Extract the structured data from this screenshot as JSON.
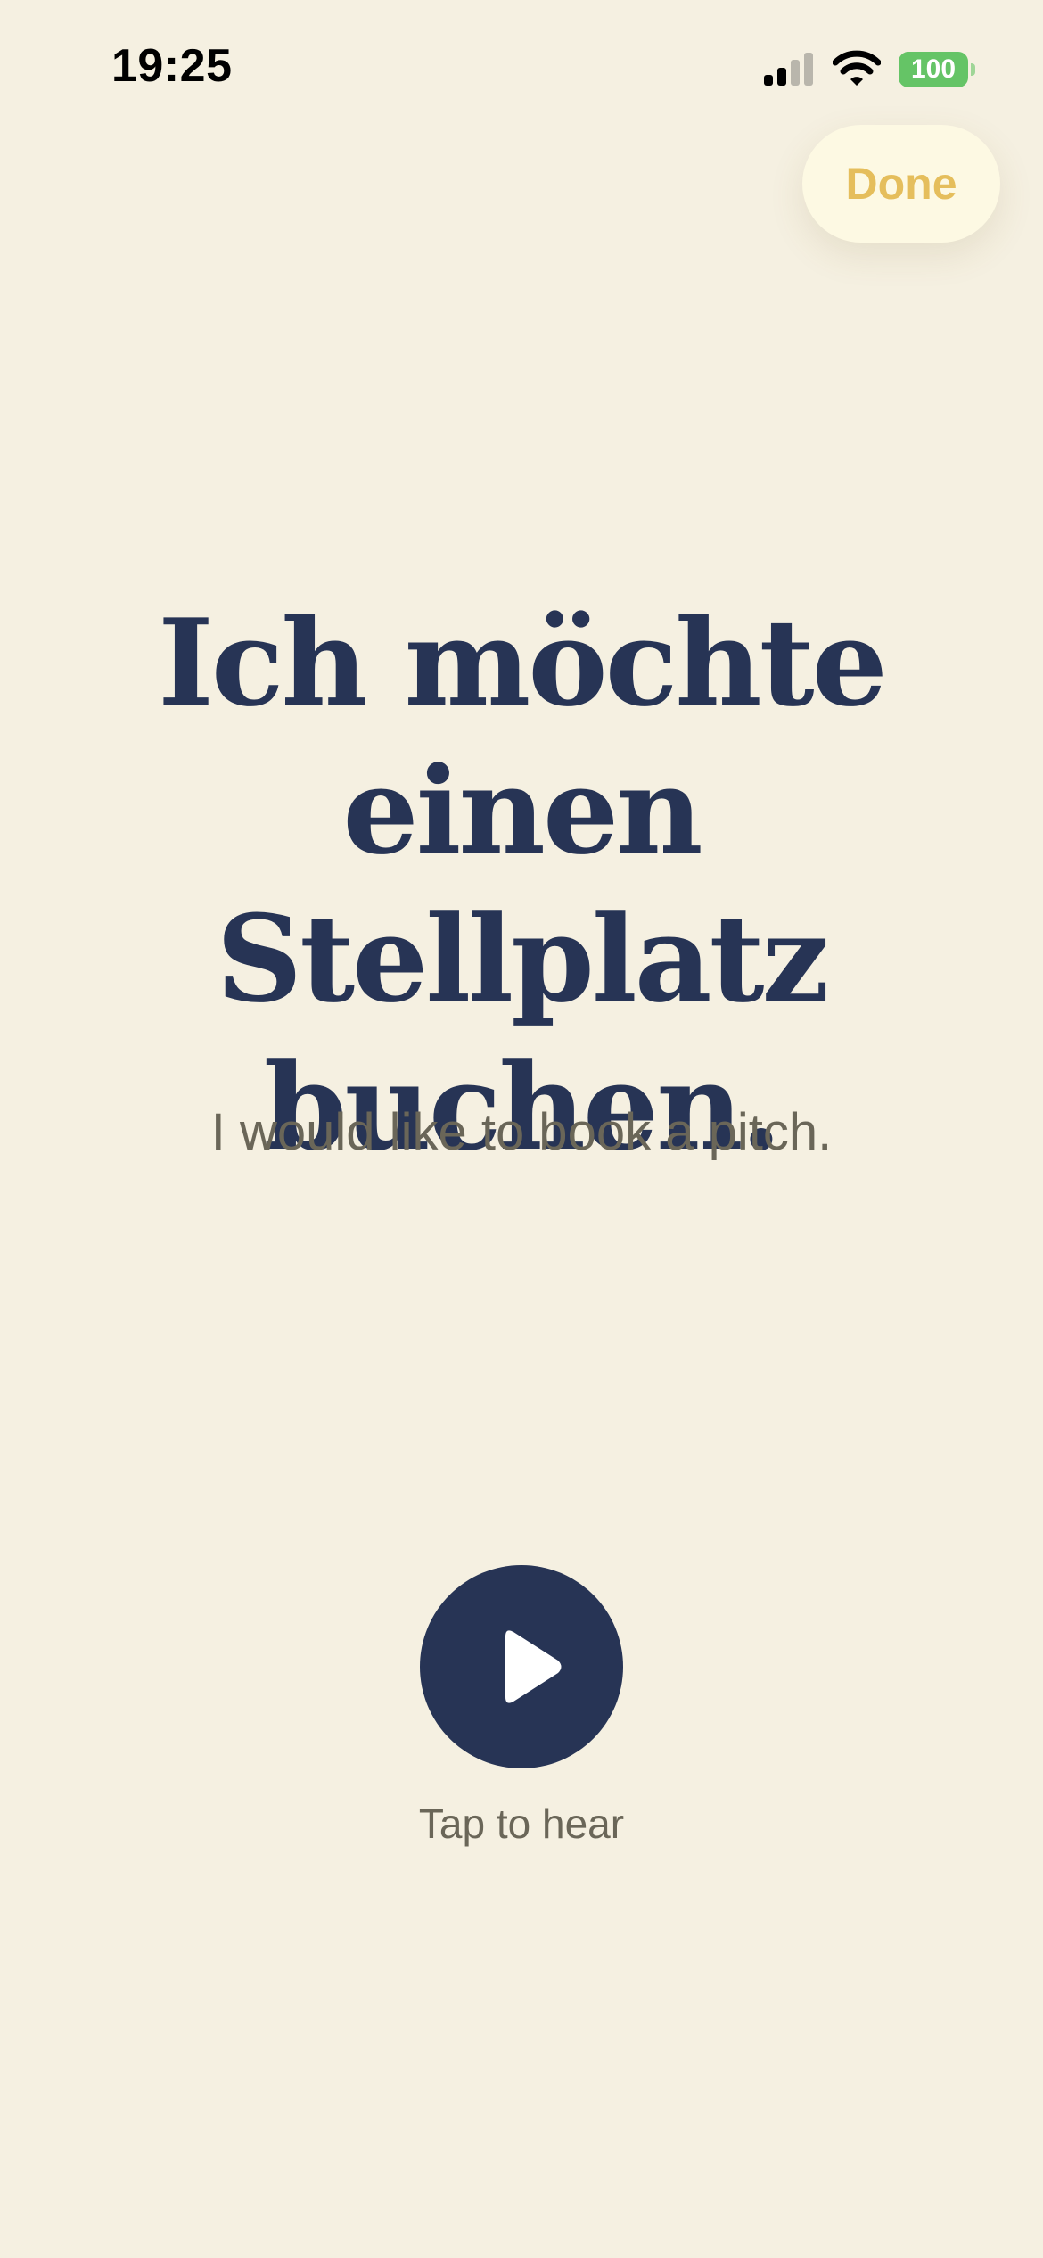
{
  "status_bar": {
    "time": "19:25",
    "battery_level": "100",
    "signal_icon": "cellular-signal-icon",
    "wifi_icon": "wifi-icon",
    "battery_color": "#65C466"
  },
  "header": {
    "done_label": "Done",
    "done_color": "#E5BE5C"
  },
  "phrase": {
    "german": "Ich möchte einen Stellplatz buchen.",
    "english": "I would like to book a pitch.",
    "text_color": "#273455"
  },
  "audio": {
    "play_icon": "play-icon",
    "button_color": "#273455",
    "label": "Tap to hear"
  },
  "theme": {
    "background": "#F5F0E1"
  }
}
